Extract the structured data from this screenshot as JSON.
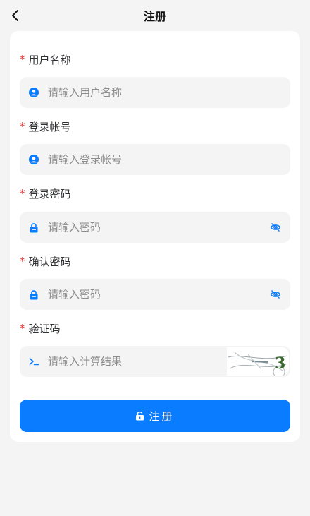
{
  "navbar": {
    "title": "注册",
    "back_icon": "chevron-left-icon"
  },
  "form": {
    "username": {
      "label": "用户名称",
      "required_mark": "*",
      "placeholder": "请输入用户名称",
      "value": "",
      "icon": "user-icon"
    },
    "account": {
      "label": "登录帐号",
      "required_mark": "*",
      "placeholder": "请输入登录帐号",
      "value": "",
      "icon": "user-icon"
    },
    "password": {
      "label": "登录密码",
      "required_mark": "*",
      "placeholder": "请输入密码",
      "value": "",
      "icon": "lock-icon",
      "toggle_icon": "eye-off-icon"
    },
    "confirm_password": {
      "label": "确认密码",
      "required_mark": "*",
      "placeholder": "请输入密码",
      "value": "",
      "icon": "lock-icon",
      "toggle_icon": "eye-off-icon"
    },
    "captcha": {
      "label": "验证码",
      "required_mark": "*",
      "placeholder": "请输入计算结果",
      "value": "",
      "icon": "terminal-icon",
      "image_text": "3"
    }
  },
  "submit": {
    "label": "注册",
    "icon": "unlock-icon"
  },
  "colors": {
    "accent": "#0a7cff",
    "required": "#f23030",
    "input_bg": "#f4f4f5",
    "page_bg": "#f4f4f4"
  }
}
